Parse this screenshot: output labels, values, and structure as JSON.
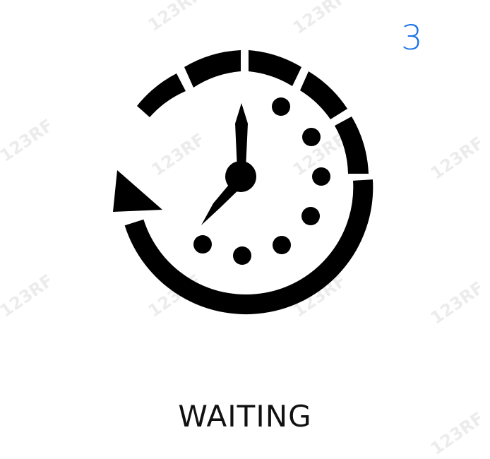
{
  "page": {
    "number": "3",
    "caption": "WAITING",
    "accent_color": "#1a73e8"
  },
  "icon": {
    "name": "clock-with-counterclockwise-arrow-icon",
    "foreground": "#000000",
    "background": "#ffffff"
  },
  "watermark": {
    "text": "123RF"
  }
}
